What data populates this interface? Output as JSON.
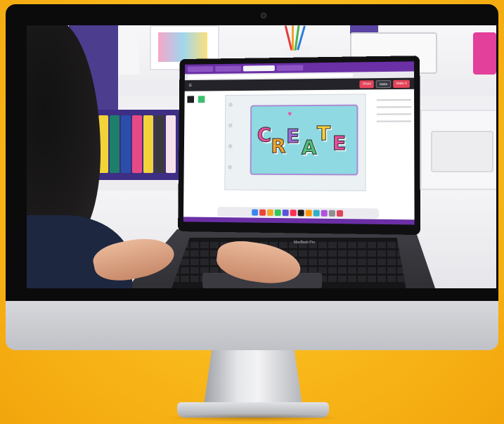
{
  "scene": {
    "subject": "",
    "colors": {
      "background": "#f9b81a",
      "app_purple": "#6b2fa6",
      "accent_pink": "#e3455a",
      "design_bg": "#8fd9e2"
    }
  },
  "laptop": {
    "brand": "MacBook Pro",
    "app": {
      "header": {
        "share_label": "Share",
        "make_label": "Make",
        "make_it_label": "Make It"
      },
      "design_text": [
        "C",
        "R",
        "E",
        "A",
        "T",
        "E"
      ],
      "design_colors": [
        "#e94fa0",
        "#f3a32b",
        "#9b6ad6",
        "#4fc07a",
        "#f9d23c",
        "#e94fa0"
      ]
    }
  }
}
